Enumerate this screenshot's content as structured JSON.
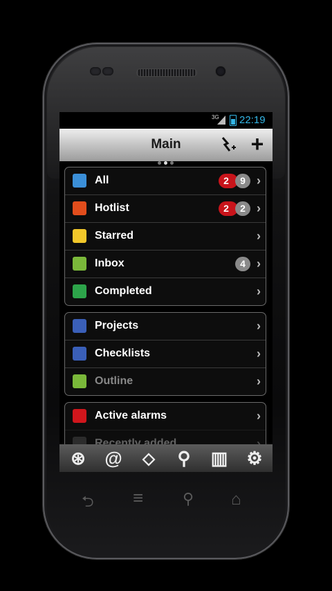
{
  "status_bar": {
    "network": "3G",
    "time": "22:19"
  },
  "action_bar": {
    "title": "Main",
    "quick_add_icon": "quick-add-icon",
    "add_icon": "+"
  },
  "lists": [
    {
      "label": "All",
      "icon": "all-tasks-icon",
      "color": "#3b8fd8",
      "badge_red": "2",
      "badge_gray": "9",
      "dim": false
    },
    {
      "label": "Hotlist",
      "icon": "hotlist-icon",
      "color": "#e24d1c",
      "badge_red": "2",
      "badge_gray": "2",
      "dim": false
    },
    {
      "label": "Starred",
      "icon": "star-icon",
      "color": "#f2c72a",
      "badge_red": "",
      "badge_gray": "",
      "dim": false
    },
    {
      "label": "Inbox",
      "icon": "inbox-icon",
      "color": "#7ab83a",
      "badge_red": "",
      "badge_gray": "4",
      "dim": false
    },
    {
      "label": "Completed",
      "icon": "check-icon",
      "color": "#2da44a",
      "badge_red": "",
      "badge_gray": "",
      "dim": false
    }
  ],
  "views": [
    {
      "label": "Projects",
      "icon": "projects-icon",
      "color": "#3a5fb8"
    },
    {
      "label": "Checklists",
      "icon": "checklist-icon",
      "color": "#3a5fb8"
    },
    {
      "label": "Outline",
      "icon": "outline-icon",
      "color": "#7ab83a"
    }
  ],
  "alarms": [
    {
      "label": "Active alarms",
      "icon": "alarm-icon",
      "color": "#d0161c"
    },
    {
      "label": "Recently added",
      "icon": "recent-icon",
      "color": "#666666"
    }
  ],
  "toolbar": [
    {
      "name": "lifebuoy-icon",
      "glyph": "⊛"
    },
    {
      "name": "at-icon",
      "glyph": "@"
    },
    {
      "name": "tag-icon",
      "glyph": "⬦"
    },
    {
      "name": "search-icon",
      "glyph": "⚲"
    },
    {
      "name": "notebook-icon",
      "glyph": "▥"
    },
    {
      "name": "settings-icon",
      "glyph": "⚙"
    }
  ],
  "nav": {
    "back": "⮌",
    "menu": "≡",
    "search": "⚲",
    "home": "⌂"
  }
}
